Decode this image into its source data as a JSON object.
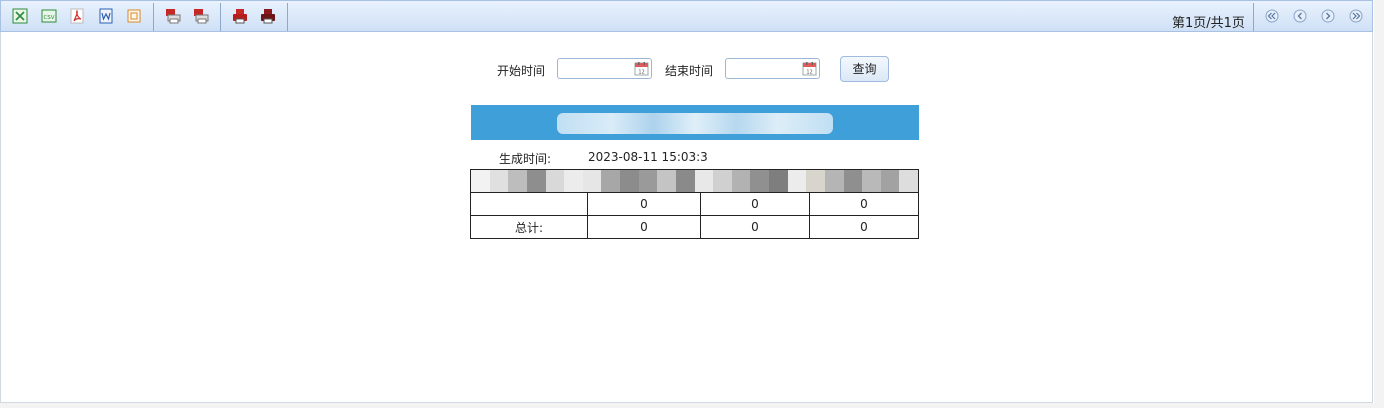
{
  "toolbar": {
    "export_icons": [
      {
        "name": "excel-export-icon",
        "color": "#2e8b3a"
      },
      {
        "name": "csv-export-icon",
        "color": "#2e8b3a"
      },
      {
        "name": "pdf-export-icon",
        "color": "#d32f2f"
      },
      {
        "name": "word-export-icon",
        "color": "#2b5fb3"
      },
      {
        "name": "html-export-icon",
        "color": "#d9892b"
      }
    ],
    "print_icons": [
      {
        "name": "flash-print-icon",
        "color": "#c62828"
      },
      {
        "name": "pdf-print-icon",
        "color": "#c62828"
      }
    ],
    "direct_print_icons": [
      {
        "name": "print-icon",
        "color": "#c62828"
      },
      {
        "name": "print-pdf-icon",
        "color": "#8b1a1a"
      }
    ],
    "pager_text": "第1页/共1页",
    "nav_icons": [
      "first-page-icon",
      "prev-page-icon",
      "next-page-icon",
      "last-page-icon"
    ]
  },
  "query": {
    "start_label": "开始时间",
    "start_value": "",
    "end_label": "结束时间",
    "end_value": "",
    "query_button": "查询"
  },
  "report": {
    "title_color": "#3e9fd9",
    "generated_label": "生成时间:",
    "generated_value": "2023-08-11  15:03:3",
    "rows": [
      {
        "label": "",
        "values": [
          "0",
          "0",
          "0"
        ]
      },
      {
        "label": "总计:",
        "values": [
          "0",
          "0",
          "0"
        ]
      }
    ]
  }
}
